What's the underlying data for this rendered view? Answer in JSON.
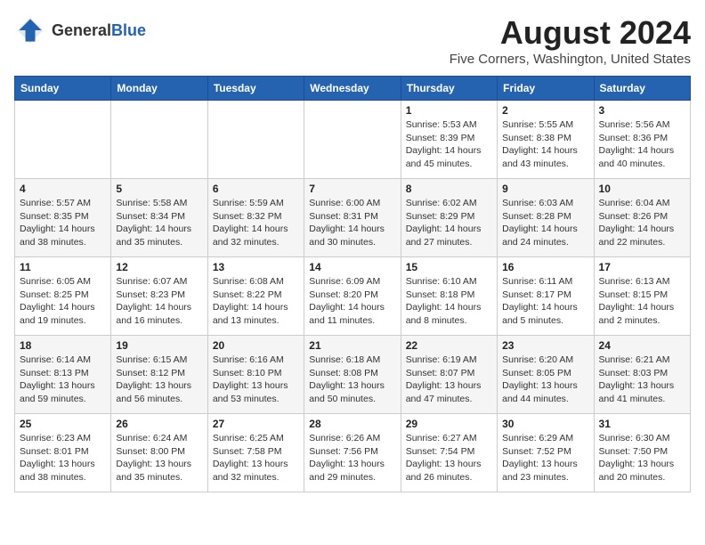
{
  "header": {
    "logo_general": "General",
    "logo_blue": "Blue",
    "month_year": "August 2024",
    "location": "Five Corners, Washington, United States"
  },
  "days_of_week": [
    "Sunday",
    "Monday",
    "Tuesday",
    "Wednesday",
    "Thursday",
    "Friday",
    "Saturday"
  ],
  "weeks": [
    [
      {
        "day": "",
        "info": ""
      },
      {
        "day": "",
        "info": ""
      },
      {
        "day": "",
        "info": ""
      },
      {
        "day": "",
        "info": ""
      },
      {
        "day": "1",
        "info": "Sunrise: 5:53 AM\nSunset: 8:39 PM\nDaylight: 14 hours\nand 45 minutes."
      },
      {
        "day": "2",
        "info": "Sunrise: 5:55 AM\nSunset: 8:38 PM\nDaylight: 14 hours\nand 43 minutes."
      },
      {
        "day": "3",
        "info": "Sunrise: 5:56 AM\nSunset: 8:36 PM\nDaylight: 14 hours\nand 40 minutes."
      }
    ],
    [
      {
        "day": "4",
        "info": "Sunrise: 5:57 AM\nSunset: 8:35 PM\nDaylight: 14 hours\nand 38 minutes."
      },
      {
        "day": "5",
        "info": "Sunrise: 5:58 AM\nSunset: 8:34 PM\nDaylight: 14 hours\nand 35 minutes."
      },
      {
        "day": "6",
        "info": "Sunrise: 5:59 AM\nSunset: 8:32 PM\nDaylight: 14 hours\nand 32 minutes."
      },
      {
        "day": "7",
        "info": "Sunrise: 6:00 AM\nSunset: 8:31 PM\nDaylight: 14 hours\nand 30 minutes."
      },
      {
        "day": "8",
        "info": "Sunrise: 6:02 AM\nSunset: 8:29 PM\nDaylight: 14 hours\nand 27 minutes."
      },
      {
        "day": "9",
        "info": "Sunrise: 6:03 AM\nSunset: 8:28 PM\nDaylight: 14 hours\nand 24 minutes."
      },
      {
        "day": "10",
        "info": "Sunrise: 6:04 AM\nSunset: 8:26 PM\nDaylight: 14 hours\nand 22 minutes."
      }
    ],
    [
      {
        "day": "11",
        "info": "Sunrise: 6:05 AM\nSunset: 8:25 PM\nDaylight: 14 hours\nand 19 minutes."
      },
      {
        "day": "12",
        "info": "Sunrise: 6:07 AM\nSunset: 8:23 PM\nDaylight: 14 hours\nand 16 minutes."
      },
      {
        "day": "13",
        "info": "Sunrise: 6:08 AM\nSunset: 8:22 PM\nDaylight: 14 hours\nand 13 minutes."
      },
      {
        "day": "14",
        "info": "Sunrise: 6:09 AM\nSunset: 8:20 PM\nDaylight: 14 hours\nand 11 minutes."
      },
      {
        "day": "15",
        "info": "Sunrise: 6:10 AM\nSunset: 8:18 PM\nDaylight: 14 hours\nand 8 minutes."
      },
      {
        "day": "16",
        "info": "Sunrise: 6:11 AM\nSunset: 8:17 PM\nDaylight: 14 hours\nand 5 minutes."
      },
      {
        "day": "17",
        "info": "Sunrise: 6:13 AM\nSunset: 8:15 PM\nDaylight: 14 hours\nand 2 minutes."
      }
    ],
    [
      {
        "day": "18",
        "info": "Sunrise: 6:14 AM\nSunset: 8:13 PM\nDaylight: 13 hours\nand 59 minutes."
      },
      {
        "day": "19",
        "info": "Sunrise: 6:15 AM\nSunset: 8:12 PM\nDaylight: 13 hours\nand 56 minutes."
      },
      {
        "day": "20",
        "info": "Sunrise: 6:16 AM\nSunset: 8:10 PM\nDaylight: 13 hours\nand 53 minutes."
      },
      {
        "day": "21",
        "info": "Sunrise: 6:18 AM\nSunset: 8:08 PM\nDaylight: 13 hours\nand 50 minutes."
      },
      {
        "day": "22",
        "info": "Sunrise: 6:19 AM\nSunset: 8:07 PM\nDaylight: 13 hours\nand 47 minutes."
      },
      {
        "day": "23",
        "info": "Sunrise: 6:20 AM\nSunset: 8:05 PM\nDaylight: 13 hours\nand 44 minutes."
      },
      {
        "day": "24",
        "info": "Sunrise: 6:21 AM\nSunset: 8:03 PM\nDaylight: 13 hours\nand 41 minutes."
      }
    ],
    [
      {
        "day": "25",
        "info": "Sunrise: 6:23 AM\nSunset: 8:01 PM\nDaylight: 13 hours\nand 38 minutes."
      },
      {
        "day": "26",
        "info": "Sunrise: 6:24 AM\nSunset: 8:00 PM\nDaylight: 13 hours\nand 35 minutes."
      },
      {
        "day": "27",
        "info": "Sunrise: 6:25 AM\nSunset: 7:58 PM\nDaylight: 13 hours\nand 32 minutes."
      },
      {
        "day": "28",
        "info": "Sunrise: 6:26 AM\nSunset: 7:56 PM\nDaylight: 13 hours\nand 29 minutes."
      },
      {
        "day": "29",
        "info": "Sunrise: 6:27 AM\nSunset: 7:54 PM\nDaylight: 13 hours\nand 26 minutes."
      },
      {
        "day": "30",
        "info": "Sunrise: 6:29 AM\nSunset: 7:52 PM\nDaylight: 13 hours\nand 23 minutes."
      },
      {
        "day": "31",
        "info": "Sunrise: 6:30 AM\nSunset: 7:50 PM\nDaylight: 13 hours\nand 20 minutes."
      }
    ]
  ]
}
